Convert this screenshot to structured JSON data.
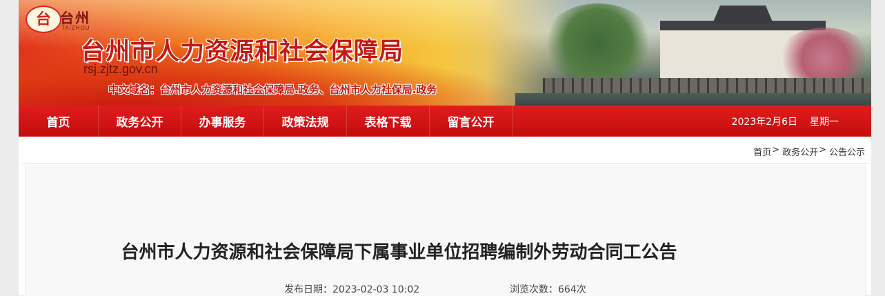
{
  "header": {
    "logo_text": "台州",
    "logo_subtext": "TAIZHOU",
    "site_title": "台州市人力资源和社会保障局",
    "site_url": "rsj.zjtz.gov.cn",
    "cn_domain_label": "中文域名：",
    "cn_domain_1": "台州市人力资源和社会保障局.政务",
    "cn_domain_sep": "、",
    "cn_domain_2": "台州市人力社保局.政务"
  },
  "nav": {
    "items": [
      {
        "label": "首页"
      },
      {
        "label": "政务公开"
      },
      {
        "label": "办事服务"
      },
      {
        "label": "政策法规"
      },
      {
        "label": "表格下载"
      },
      {
        "label": "留言公开"
      }
    ],
    "date": "2023年2月6日",
    "weekday": "星期一"
  },
  "breadcrumb": {
    "items": [
      {
        "label": "首页"
      },
      {
        "label": "政务公开"
      },
      {
        "label": "公告公示"
      }
    ],
    "separator": ">"
  },
  "article": {
    "title": "台州市人力资源和社会保障局下属事业单位招聘编制外劳动合同工公告",
    "publish_date": "发布日期：2023-02-03 10:02",
    "views": "浏览次数：664次"
  },
  "colors": {
    "nav_red": "#d41515",
    "title_red": "#c31914",
    "page_background": "#ececec"
  }
}
